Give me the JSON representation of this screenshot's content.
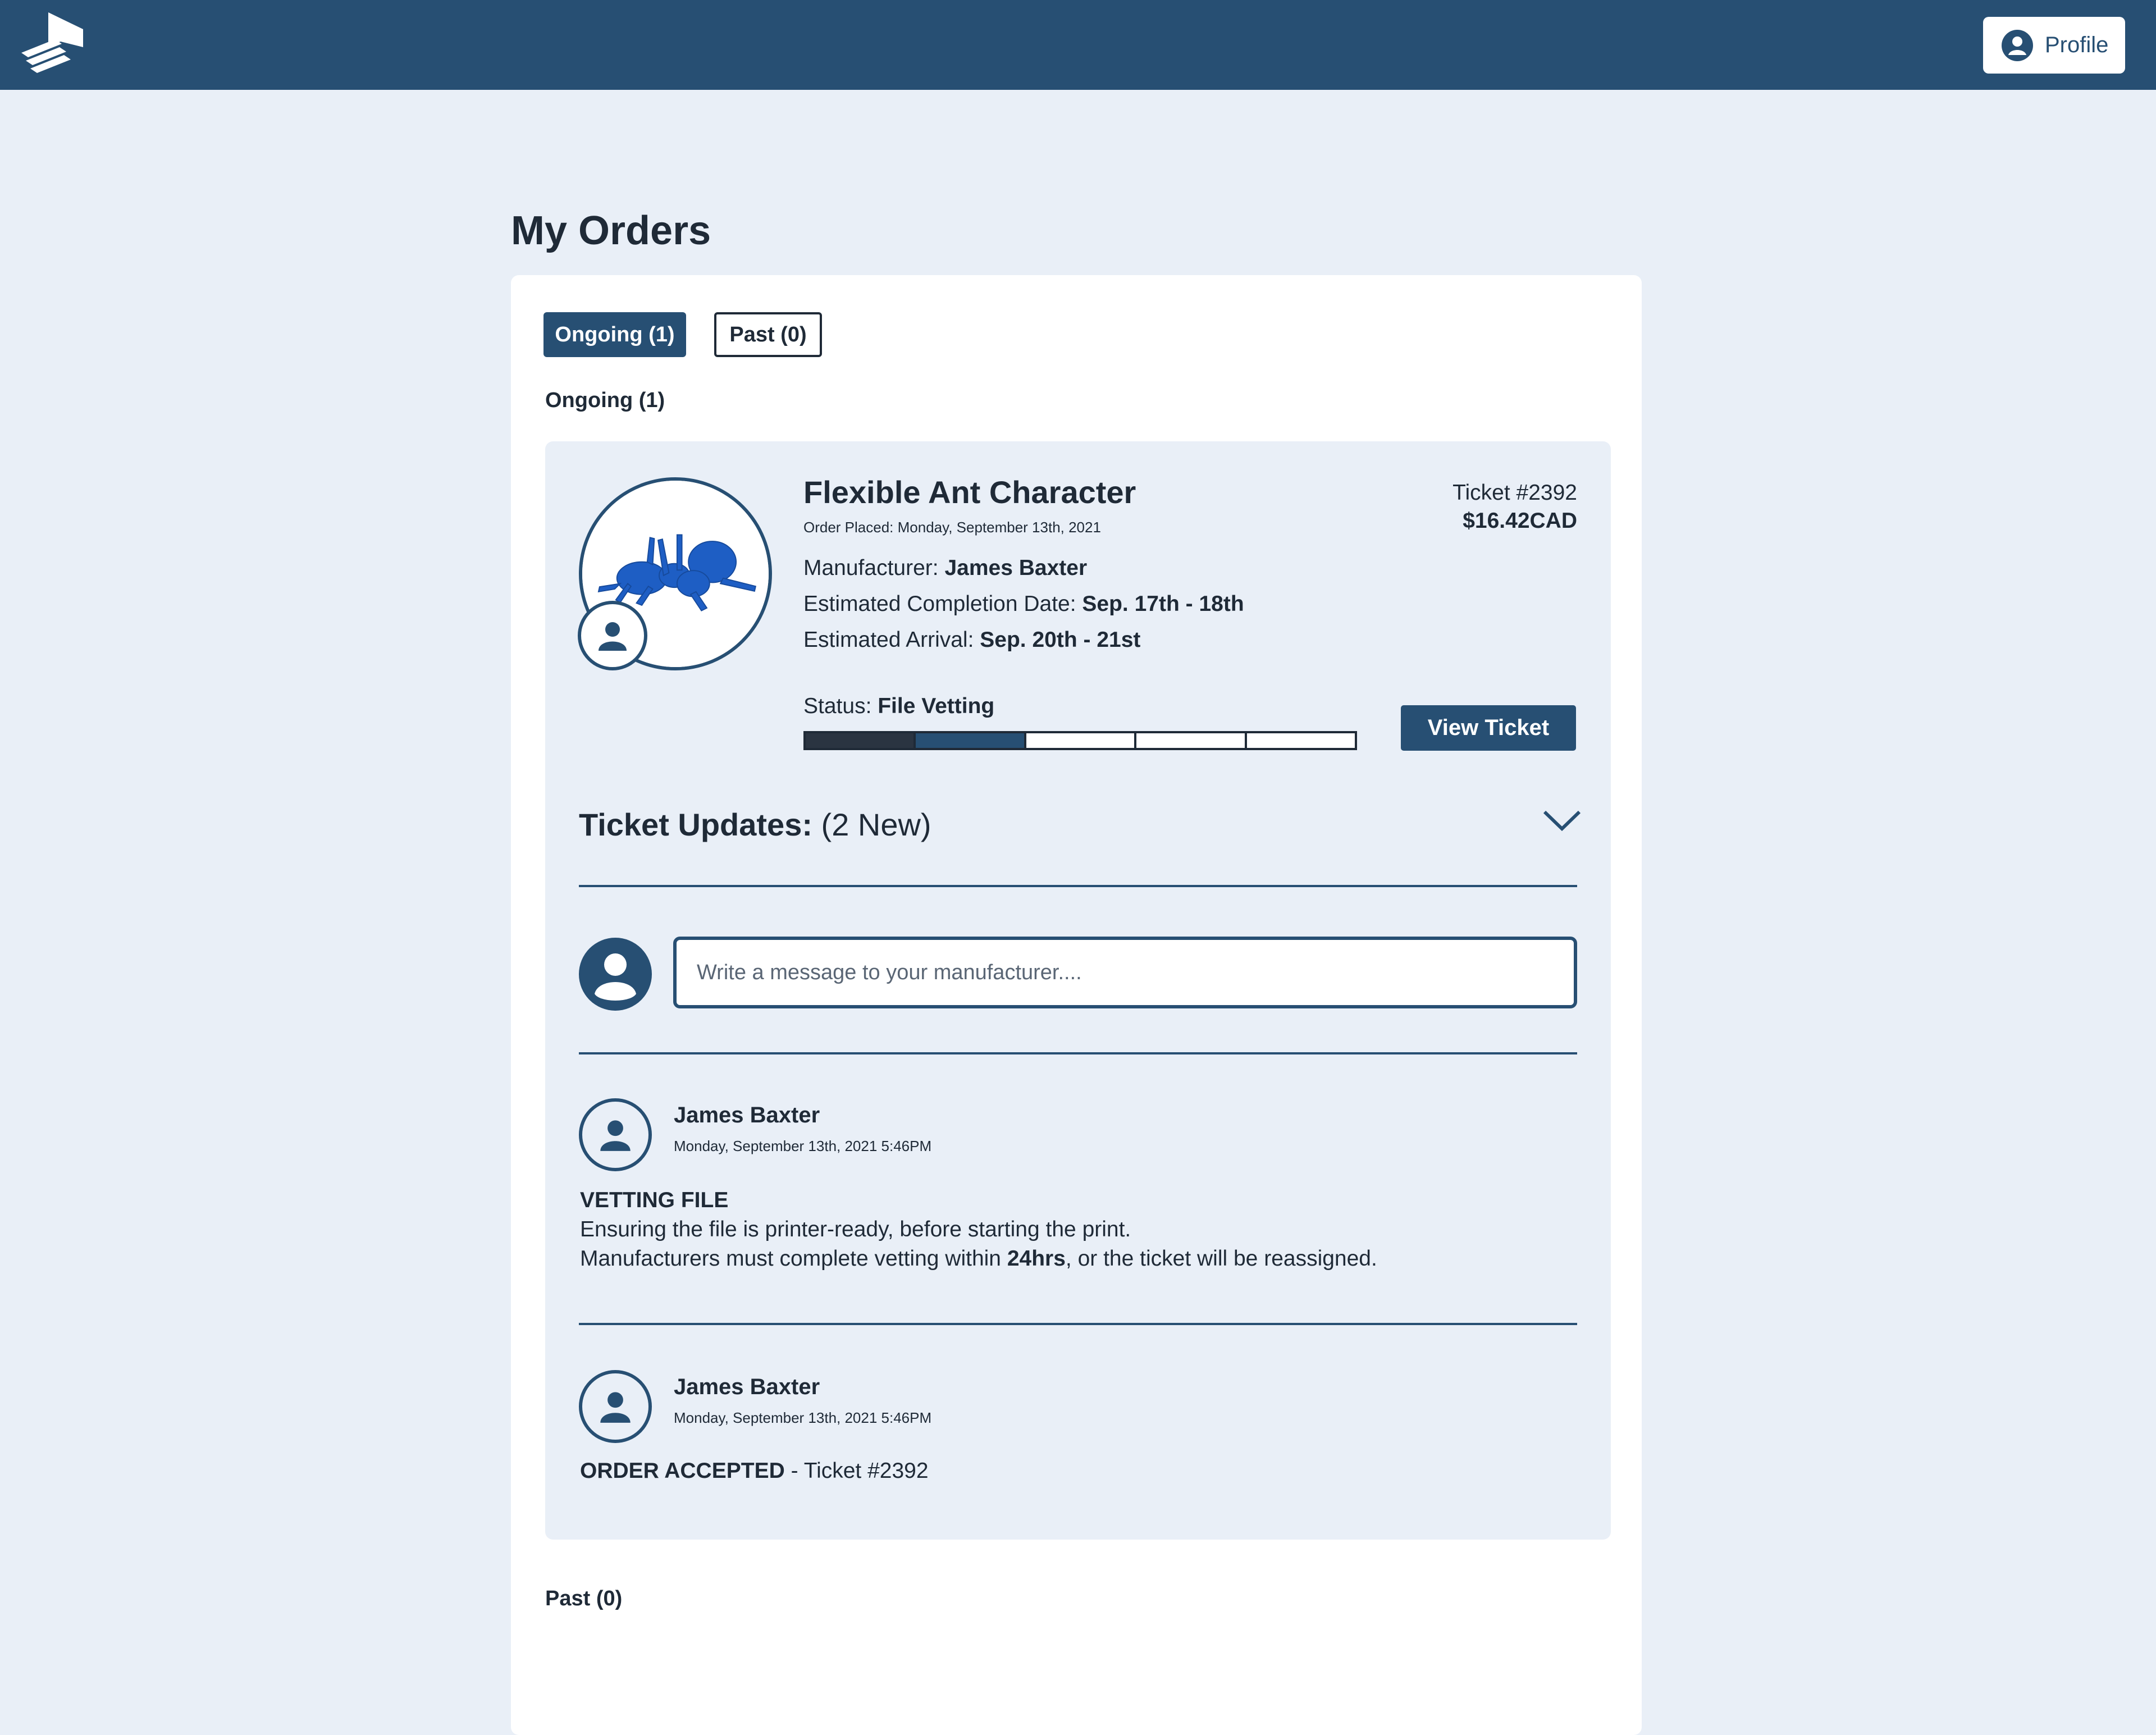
{
  "header": {
    "profile_label": "Profile"
  },
  "page": {
    "title": "My Orders"
  },
  "tabs": [
    {
      "label": "Ongoing (1)",
      "active": true
    },
    {
      "label": "Past (0)",
      "active": false
    }
  ],
  "sections": {
    "ongoing_label": "Ongoing (1)",
    "past_label": "Past (0)"
  },
  "order": {
    "title": "Flexible Ant Character",
    "placed": "Order Placed: Monday, September 13th, 2021",
    "ticket_number": "Ticket #2392",
    "price": "$16.42CAD",
    "manufacturer_label": "Manufacturer: ",
    "manufacturer": "James Baxter",
    "completion_label": "Estimated Completion Date: ",
    "completion": "Sep. 17th - 18th",
    "arrival_label": "Estimated Arrival: ",
    "arrival": "Sep. 20th - 21st",
    "status_label": "Status: ",
    "status": "File Vetting",
    "progress_steps_total": 5,
    "progress_steps_done": 1,
    "progress_step_active": 2,
    "view_ticket_label": "View Ticket"
  },
  "ticket_updates": {
    "title": "Ticket Updates:",
    "new_count": " (2 New)",
    "message_placeholder": "Write a message to your manufacturer....",
    "items": [
      {
        "author": "James Baxter",
        "time": "Monday, September 13th, 2021 5:46PM",
        "heading": "VETTING FILE",
        "line1": "Ensuring the file is printer-ready, before starting the print.",
        "line2_pre": "Manufacturers must complete vetting within ",
        "line2_bold": "24hrs",
        "line2_post": ", or the ticket will be reassigned."
      },
      {
        "author": "James Baxter",
        "time": "Monday, September 13th, 2021 5:46PM",
        "heading": "ORDER ACCEPTED",
        "suffix": " - Ticket #2392"
      }
    ]
  },
  "colors": {
    "brand": "#274f73",
    "background": "#e9eff7",
    "text": "#1f2a37"
  },
  "icons": [
    "logo-icon",
    "user-circle-icon",
    "chevron-down-icon",
    "user-icon"
  ]
}
